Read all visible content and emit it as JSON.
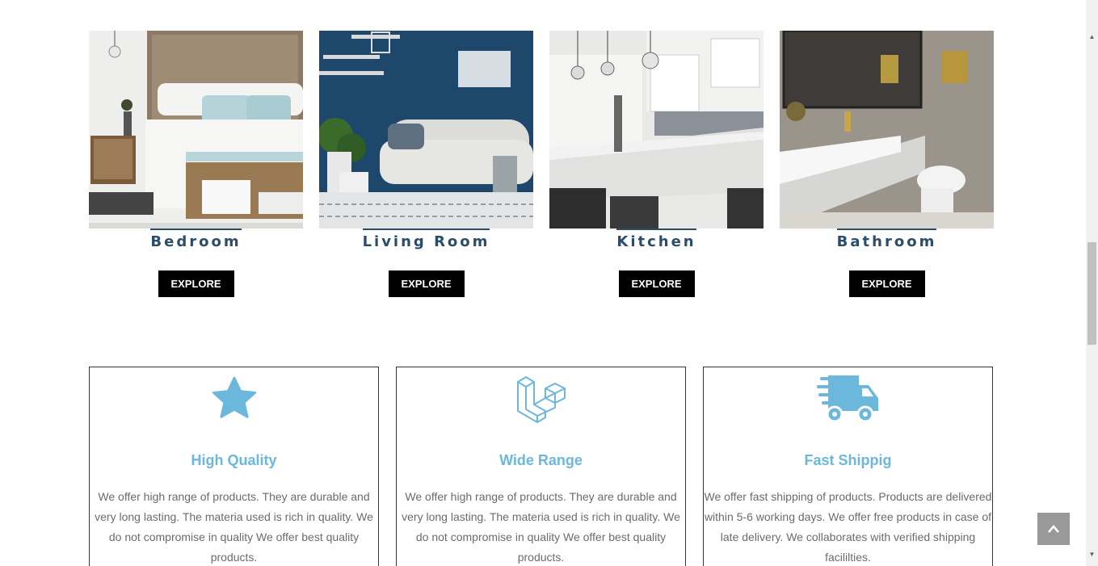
{
  "categories": [
    {
      "title": "Bedroom",
      "button": "EXPLORE"
    },
    {
      "title": "Living Room",
      "button": "EXPLORE"
    },
    {
      "title": "Kitchen",
      "button": "EXPLORE"
    },
    {
      "title": "Bathroom",
      "button": "EXPLORE"
    }
  ],
  "features": [
    {
      "icon": "star-icon",
      "title": "High Quality",
      "text": "We offer high range of products. They are durable and very long lasting. The materia used is rich in quality. We do not compromise in quality We offer best quality products."
    },
    {
      "icon": "laravel-cube-icon",
      "title": "Wide Range",
      "text": "We offer high range of products. They are durable and very long lasting. The materia used is rich in quality. We do not compromise in quality We offer best quality products."
    },
    {
      "icon": "truck-icon",
      "title": "Fast Shippig",
      "text": "We offer fast shipping of products. Products are delivered within 5-6 working days. We offer free products in case of late delivery. We collaborates with verified shipping facililties."
    }
  ],
  "colors": {
    "accent": "#6bb8dc",
    "heading": "#2a4d69",
    "button": "#000000"
  },
  "back_to_top": {
    "icon": "chevron-up-icon"
  }
}
